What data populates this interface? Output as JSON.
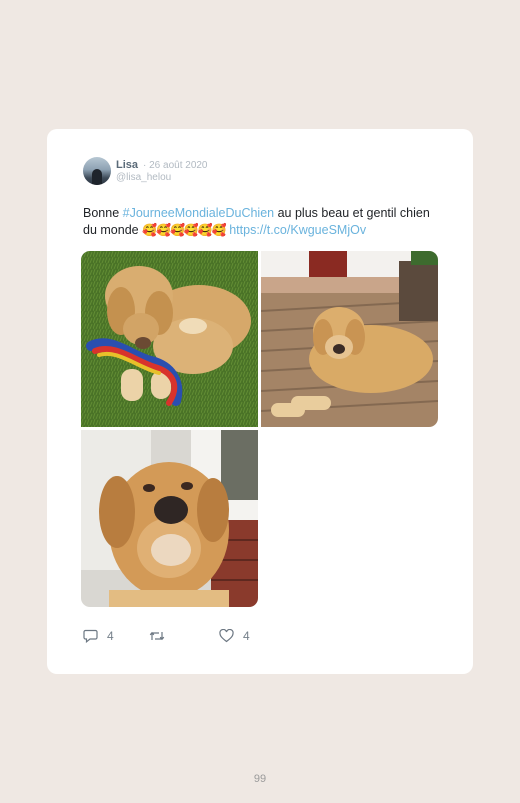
{
  "tweet": {
    "author_name": "Lisa",
    "date": "· 26 août 2020",
    "handle": "@lisa_helou",
    "text_prefix": "Bonne ",
    "hashtag": "#JourneeMondialeDuChien",
    "text_middle": " au plus beau et gentil chien du monde ",
    "emojis": "🥰🥰🥰🥰🥰🥰",
    "link": "https://t.co/KwgueSMjOv",
    "photos": [
      {
        "description": "dog-on-grass-with-rope-toy"
      },
      {
        "description": "dog-lying-on-deck"
      },
      {
        "description": "dog-face-closeup"
      }
    ],
    "actions": {
      "replies": "4",
      "retweets": "",
      "likes": "4"
    }
  },
  "icons": [
    "reply-icon",
    "retweet-icon",
    "like-icon"
  ],
  "colors": {
    "background": "#efe8e3",
    "card": "#ffffff",
    "link": "#6ab3dd",
    "muted": "#b2bac2"
  },
  "page": {
    "number": "99"
  }
}
